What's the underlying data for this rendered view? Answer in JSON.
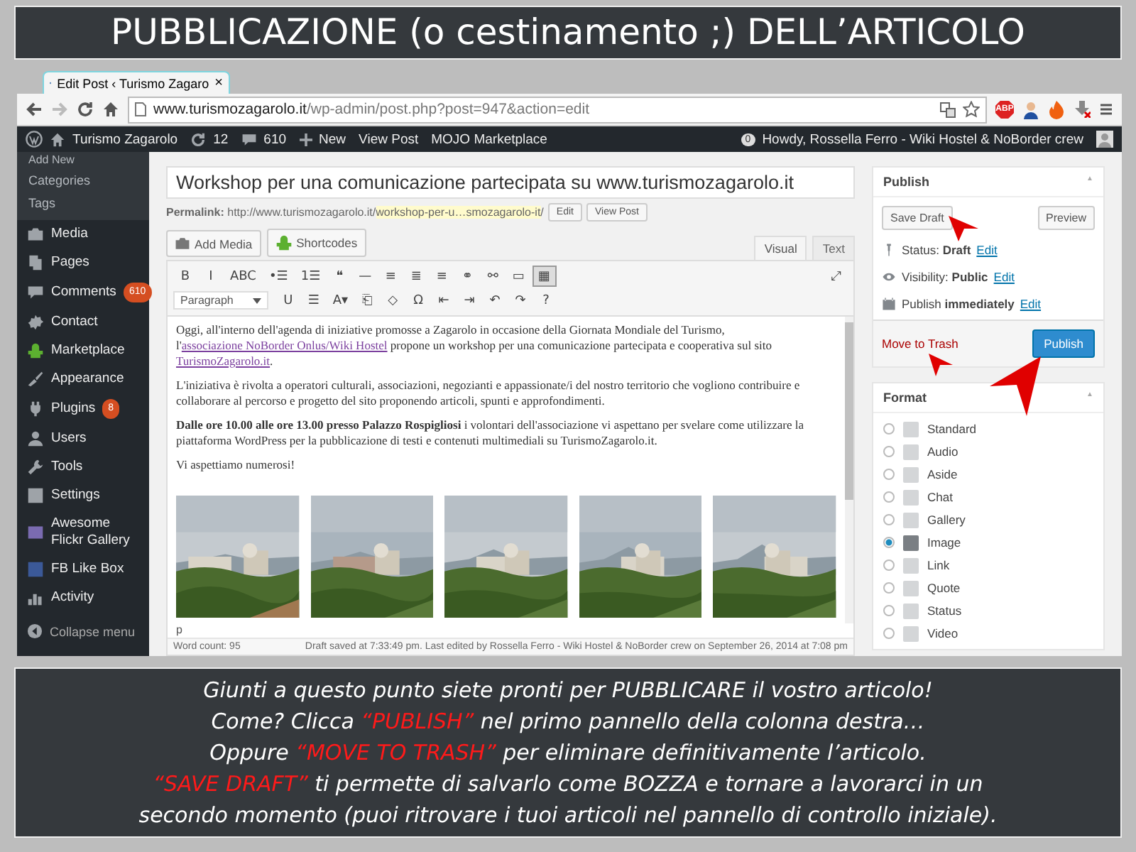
{
  "slide_title": "PUBBLICAZIONE (o cestinamento ;) DELL’ARTICOLO",
  "browser": {
    "tab_title": "Edit Post ‹ Turismo Zagaro",
    "tab_close": "×",
    "host": "www.turismozagarolo.it",
    "path": "/wp-admin/post.php?post=947&action=edit",
    "extension_badge": "ABP"
  },
  "admin_bar": {
    "site": "Turismo Zagarolo",
    "updates": "12",
    "comments": "610",
    "new": "New",
    "links": [
      "View Post",
      "MOJO Marketplace"
    ],
    "notifications": "0",
    "greeting": "Howdy, Rossella Ferro - Wiki Hostel & NoBorder crew"
  },
  "sidebar": {
    "submenu": [
      {
        "label": "Add New",
        "selected": false
      },
      {
        "label": "Categories",
        "selected": false
      },
      {
        "label": "Tags",
        "selected": false
      }
    ],
    "items": [
      {
        "label": "Media",
        "selected": false
      },
      {
        "label": "Pages",
        "selected": false
      },
      {
        "label": "Comments",
        "badge": "610",
        "selected": false
      },
      {
        "label": "Contact",
        "selected": false
      },
      {
        "label": "Marketplace",
        "selected": false
      },
      {
        "label": "Appearance",
        "selected": false
      },
      {
        "label": "Plugins",
        "badge": "8",
        "selected": false
      },
      {
        "label": "Users",
        "selected": false
      },
      {
        "label": "Tools",
        "selected": false
      },
      {
        "label": "Settings",
        "selected": false
      },
      {
        "label": "Awesome Flickr Gallery",
        "selected": false
      },
      {
        "label": "FB Like Box",
        "selected": false
      },
      {
        "label": "Activity",
        "selected": false
      }
    ],
    "collapse": "Collapse menu"
  },
  "editor": {
    "title": "Workshop per una comunicazione partecipata su www.turismozagarolo.it",
    "permalink": {
      "label": "Permalink:",
      "base": "http://www.turismozagarolo.it/",
      "slug": "workshop-per-u…smozagarolo-it",
      "tail": "/",
      "buttons": [
        "Edit",
        "View Post"
      ]
    },
    "media_buttons": [
      "Add Media",
      "Shortcodes"
    ],
    "tabs": [
      {
        "label": "Visual",
        "selected": true
      },
      {
        "label": "Text",
        "selected": false
      }
    ],
    "toolbar_row_1": [
      "B",
      "I",
      "ABC",
      "•☰",
      "1☰",
      "❝",
      "—",
      "≡",
      "≣",
      "≡",
      "⚭",
      "⚯",
      "▭",
      "▦"
    ],
    "toolbar_fullscreen": "⤢",
    "format_select": "Paragraph",
    "toolbar_row_2": [
      "U",
      "☰",
      "A▾",
      "⎗",
      "◇",
      "Ω",
      "⇤",
      "⇥",
      "↶",
      "↷",
      "?"
    ],
    "paragraphs": [
      [
        {
          "text": "Oggi, all'interno dell'agenda di iniziative promosse a Zagarolo in occasione della Giornata Mondiale del Turismo, l'",
          "kind": "plain"
        },
        {
          "text": "associazione NoBorder Onlus/Wiki Hostel",
          "kind": "link"
        },
        {
          "text": " propone un workshop per una comunicazione partecipata e cooperativa sul sito ",
          "kind": "plain"
        },
        {
          "text": "TurismoZagarolo.it",
          "kind": "link"
        },
        {
          "text": ".",
          "kind": "plain"
        }
      ],
      [
        {
          "text": "L'iniziativa è rivolta a operatori culturali, associazioni, negozianti e appassionate/i del nostro territorio che vogliono contribuire e collaborare al percorso e progetto del sito proponendo articoli, spunti e approfondimenti.",
          "kind": "plain"
        }
      ],
      [
        {
          "text": "Dalle ore 10.00 alle ore 13.00 presso Palazzo Rospigliosi",
          "kind": "bold"
        },
        {
          "text": " i volontari dell'associazione vi aspettano per svelare come utilizzare la piattaforma WordPress per la pubblicazione di testi e contenuti multimediali su TurismoZagarolo.it.",
          "kind": "plain"
        }
      ],
      [
        {
          "text": "Vi aspettiamo numerosi!",
          "kind": "plain"
        }
      ]
    ],
    "gallery": [
      {
        "kind": "picture"
      },
      {
        "kind": "picture"
      },
      {
        "kind": "picture"
      },
      {
        "kind": "picture"
      },
      {
        "kind": "picture"
      }
    ],
    "path": "p",
    "word_count": "Word count: 95",
    "save_status": "Draft saved at 7:33:49 pm. Last edited by Rossella Ferro - Wiki Hostel & NoBorder crew on September 26, 2014 at 7:08 pm"
  },
  "publish": {
    "title": "Publish",
    "toggle": "▲",
    "save_draft": "Save Draft",
    "preview": "Preview",
    "rows": [
      {
        "text": "Status: **Draft**",
        "link": "Edit"
      },
      {
        "text": "Visibility: **Public**",
        "link": "Edit"
      },
      {
        "text": "Publish **immediately**",
        "link": "Edit"
      }
    ],
    "trash": "Move to Trash",
    "publish": "Publish"
  },
  "format": {
    "title": "Format",
    "toggle": "▲",
    "options": [
      {
        "label": "Standard",
        "selected": false
      },
      {
        "label": "Audio",
        "selected": false
      },
      {
        "label": "Aside",
        "selected": false
      },
      {
        "label": "Chat",
        "selected": false
      },
      {
        "label": "Gallery",
        "selected": false
      },
      {
        "label": "Image",
        "selected": true
      },
      {
        "label": "Link",
        "selected": false
      },
      {
        "label": "Quote",
        "selected": false
      },
      {
        "label": "Status",
        "selected": false
      },
      {
        "label": "Video",
        "selected": false
      }
    ]
  },
  "caption": [
    [
      {
        "text": "Giunti a questo punto siete pronti per PUBBLICARE il vostro articolo!",
        "highlight": false
      }
    ],
    [
      {
        "text": "Come? Clicca ",
        "highlight": false
      },
      {
        "text": "“PUBLISH”",
        "highlight": true
      },
      {
        "text": " nel primo pannello della colonna destra…",
        "highlight": false
      }
    ],
    [
      {
        "text": "Oppure ",
        "highlight": false
      },
      {
        "text": "“MOVE TO TRASH”",
        "highlight": true
      },
      {
        "text": " per eliminare definitivamente l’articolo.",
        "highlight": false
      }
    ],
    [
      {
        "text": "“SAVE DRAFT”",
        "highlight": true
      },
      {
        "text": " ti permette di salvarlo come BOZZA e tornare a lavorarci in un",
        "highlight": false
      }
    ],
    [
      {
        "text": "secondo momento (puoi ritrovare i tuoi articoli nel pannello di controllo iniziale).",
        "highlight": false
      }
    ]
  ]
}
